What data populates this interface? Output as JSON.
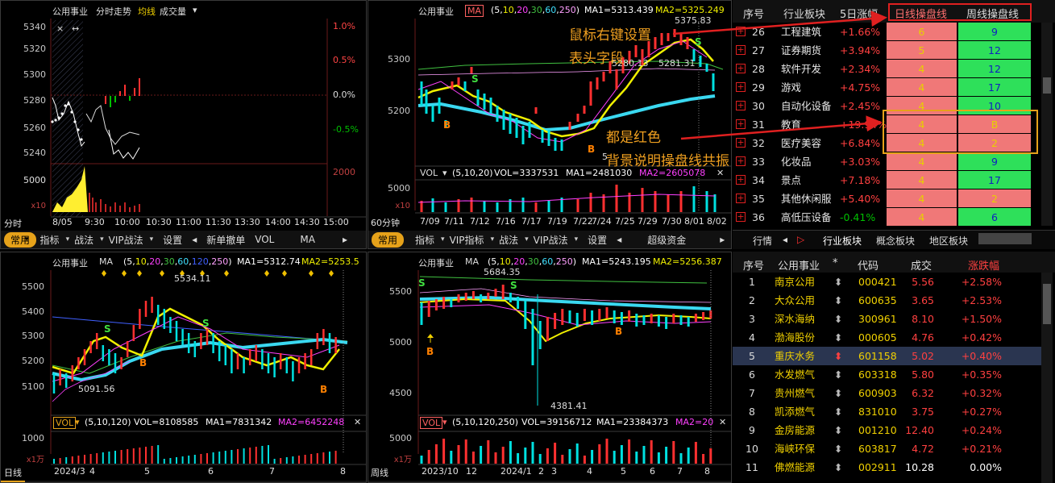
{
  "tl": {
    "title": "公用事业",
    "subtitle": "分时走势",
    "mode1": "均线",
    "mode2": "成交量",
    "y_left": [
      "5340",
      "5320",
      "5300",
      "5280",
      "5260",
      "5240"
    ],
    "y_right": [
      "1.0%",
      "0.5%",
      "0.0%",
      "-0.5%"
    ],
    "vol_left": "5000",
    "vol_right": "2000",
    "vol_unit": "x10",
    "period": "分时",
    "x_labels": [
      "8/05",
      "9:30",
      "10:00",
      "10:30",
      "11:00",
      "11:30",
      "13:30",
      "14:00",
      "14:30",
      "15:00"
    ],
    "toolbar": [
      "常用",
      "指标",
      "战法",
      "VIP战法",
      "设置",
      "新单撤单",
      "VOL",
      "MA"
    ]
  },
  "tm": {
    "title": "公用事业",
    "ma_label": "MA",
    "ma_params": "(5,10,20,30,60,250)",
    "ma1": "MA1=5313.439",
    "ma2": "MA2=5325.249",
    "high": "5375.83",
    "mid_price": "5280.13",
    "mid_price2": "5281.31",
    "low_mark": "5",
    "y_labels": [
      "5300",
      "5200"
    ],
    "vol_label": "VOL",
    "vol_params": "(5,10,20)",
    "vol_val": "VOL=3337531",
    "vol_ma1": "MA1=2481030",
    "vol_ma2": "MA2=2605078",
    "vol_y": "5000",
    "vol_unit": "x10",
    "period": "60分钟",
    "x_labels": [
      "7/09",
      "7/11",
      "7/12",
      "7/16",
      "7/17",
      "7/19",
      "7/22",
      "7/24",
      "7/25",
      "7/29",
      "7/30",
      "8/01",
      "8/02"
    ],
    "toolbar": [
      "常用",
      "指标",
      "VIP指标",
      "战法",
      "VIP战法",
      "设置",
      "超级资金"
    ]
  },
  "bl": {
    "title": "公用事业",
    "ma_label": "MA",
    "ma_params": "(5,10,20,30,60,120,250)",
    "ma1": "MA1=5312.74",
    "ma2": "MA2=5253.5",
    "high": "5534.11",
    "low": "5091.56",
    "y_labels": [
      "5500",
      "5400",
      "5300",
      "5200",
      "5100"
    ],
    "vol_label": "VOL",
    "vol_params": "(5,10,120)",
    "vol_val": "VOL=8108585",
    "vol_ma1": "MA1=7831342",
    "vol_ma2": "MA2=6452248",
    "vol_y": "1000",
    "vol_unit": "x1万",
    "period": "日线",
    "x_labels": [
      "2024/3",
      "4",
      "5",
      "6",
      "7",
      "8"
    ]
  },
  "bm": {
    "title": "公用事业",
    "ma_label": "MA",
    "ma_params": "(5,10,20,30,60,250)",
    "ma1": "MA1=5243.195",
    "ma2": "MA2=5256.387",
    "high": "5684.35",
    "low": "4381.41",
    "y_labels": [
      "5500",
      "5000",
      "4500"
    ],
    "vol_label": "VOL",
    "vol_params": "(5,10,120,250)",
    "vol_val": "VOL=39156712",
    "vol_ma1": "MA1=23384373",
    "vol_ma2": "MA2=20",
    "vol_y": "5000",
    "vol_unit": "x1万",
    "period": "周线",
    "x_labels": [
      "2023/10",
      "12",
      "2024/1",
      "2",
      "3",
      "4",
      "5",
      "6",
      "7",
      "8"
    ]
  },
  "sector_table": {
    "headers": [
      "序号",
      "行业板块",
      "5日涨幅",
      "日线操盘线",
      "周线操盘线"
    ],
    "rows": [
      {
        "no": "26",
        "name": "工程建筑",
        "chg": "+1.66%",
        "d": "6",
        "w": "9",
        "wc": "g"
      },
      {
        "no": "27",
        "name": "证券期货",
        "chg": "+3.94%",
        "d": "5",
        "w": "12",
        "wc": "g"
      },
      {
        "no": "28",
        "name": "软件开发",
        "chg": "+2.34%",
        "d": "4",
        "w": "12",
        "wc": "g"
      },
      {
        "no": "29",
        "name": "游戏",
        "chg": "+4.75%",
        "d": "4",
        "w": "17",
        "wc": "g"
      },
      {
        "no": "30",
        "name": "自动化设备",
        "chg": "+2.45%",
        "d": "4",
        "w": "10",
        "wc": "g"
      },
      {
        "no": "31",
        "name": "教育",
        "chg": "+19.94%",
        "d": "4",
        "w": "B",
        "wc": "r"
      },
      {
        "no": "32",
        "name": "医疗美容",
        "chg": "+6.84%",
        "d": "4",
        "w": "2",
        "wc": "r"
      },
      {
        "no": "33",
        "name": "化妆品",
        "chg": "+3.03%",
        "d": "4",
        "w": "9",
        "wc": "g"
      },
      {
        "no": "34",
        "name": "景点",
        "chg": "+7.18%",
        "d": "4",
        "w": "17",
        "wc": "g"
      },
      {
        "no": "35",
        "name": "其他休闲服",
        "chg": "+5.40%",
        "d": "4",
        "w": "2",
        "wc": "r"
      },
      {
        "no": "36",
        "name": "高低压设备",
        "chg": "-0.41%",
        "d": "4",
        "w": "6",
        "wc": "g"
      }
    ],
    "tabs": [
      "行情",
      "行业板块",
      "概念板块",
      "地区板块"
    ]
  },
  "annotations": {
    "a1": "鼠标右键设置",
    "a2": "表头字段",
    "a3": "都是红色",
    "a4": "背景说明操盘线共振"
  },
  "stock_table": {
    "headers": [
      "序号",
      "公用事业",
      "*",
      "代码",
      "成交",
      "涨跌幅"
    ],
    "rows": [
      {
        "no": "1",
        "name": "南京公用",
        "code": "000421",
        "price": "5.56",
        "chg": "+2.58%"
      },
      {
        "no": "2",
        "name": "大众公用",
        "code": "600635",
        "price": "3.65",
        "chg": "+2.53%"
      },
      {
        "no": "3",
        "name": "深水海纳",
        "code": "300961",
        "price": "8.10",
        "chg": "+1.50%"
      },
      {
        "no": "4",
        "name": "渤海股份",
        "code": "000605",
        "price": "4.76",
        "chg": "+0.42%"
      },
      {
        "no": "5",
        "name": "重庆水务",
        "code": "601158",
        "price": "5.02",
        "chg": "+0.40%"
      },
      {
        "no": "6",
        "name": "水发燃气",
        "code": "603318",
        "price": "5.80",
        "chg": "+0.35%"
      },
      {
        "no": "7",
        "name": "贵州燃气",
        "code": "600903",
        "price": "6.32",
        "chg": "+0.32%"
      },
      {
        "no": "8",
        "name": "凯添燃气",
        "code": "831010",
        "price": "3.75",
        "chg": "+0.27%"
      },
      {
        "no": "9",
        "name": "金房能源",
        "code": "001210",
        "price": "12.40",
        "chg": "+0.24%"
      },
      {
        "no": "10",
        "name": "海峡环保",
        "code": "603817",
        "price": "4.72",
        "chg": "+0.21%"
      },
      {
        "no": "11",
        "name": "佛燃能源",
        "code": "002911",
        "price": "10.28",
        "chg": "0.00%"
      }
    ]
  },
  "colors": {
    "up": "#ff3030",
    "down": "#00e0e0",
    "ma5": "#ffffff",
    "ma10": "#f0f000",
    "ma_thick": "#3ad8f0",
    "accent": "#e6a21a"
  }
}
